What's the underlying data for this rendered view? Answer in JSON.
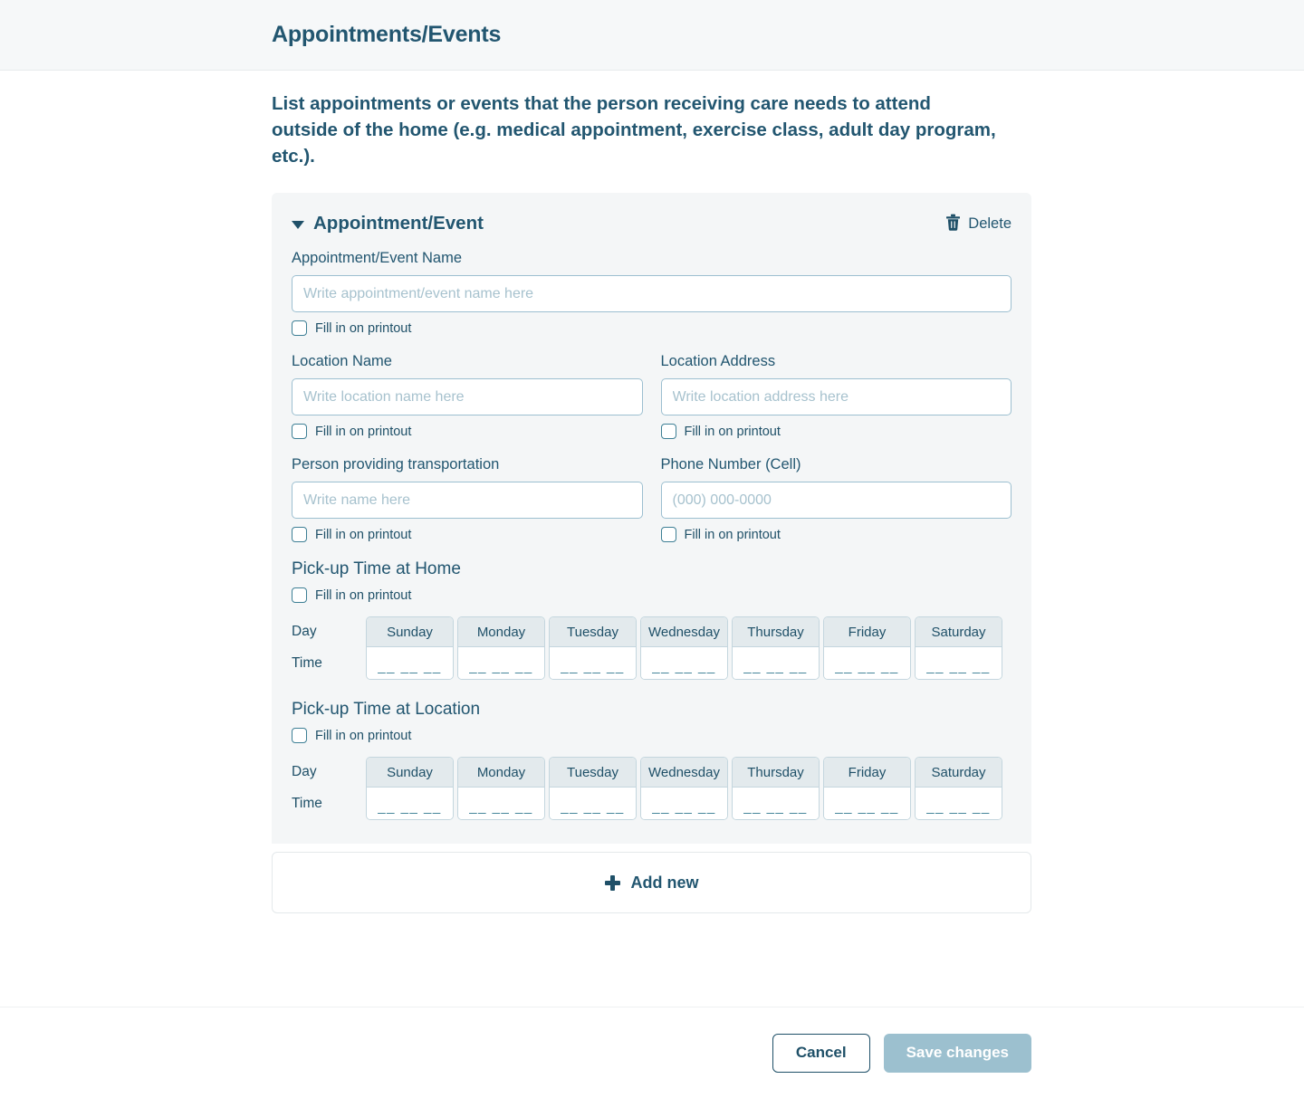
{
  "header": {
    "title": "Appointments/Events"
  },
  "intro": {
    "text": "List appointments or events that the person receiving care needs to attend outside of the home (e.g. medical appointment, exercise class, adult day program, etc.)."
  },
  "card": {
    "title": "Appointment/Event",
    "delete_label": "Delete",
    "caret_icon": "caret-down-icon",
    "delete_icon": "trash-icon",
    "fields": {
      "event_name": {
        "label": "Appointment/Event Name",
        "placeholder": "Write appointment/event name here",
        "value": "",
        "printout_label": "Fill in on printout",
        "printout_checked": false
      },
      "location_name": {
        "label": "Location Name",
        "placeholder": "Write location name here",
        "value": "",
        "printout_label": "Fill in on printout",
        "printout_checked": false
      },
      "location_address": {
        "label": "Location Address",
        "placeholder": "Write location address here",
        "value": "",
        "printout_label": "Fill in on printout",
        "printout_checked": false
      },
      "transport_person": {
        "label": "Person providing transportation",
        "placeholder": "Write name here",
        "value": "",
        "printout_label": "Fill in on printout",
        "printout_checked": false
      },
      "phone_number": {
        "label": "Phone Number (Cell)",
        "placeholder": "(000) 000-0000",
        "value": "",
        "printout_label": "Fill in on printout",
        "printout_checked": false
      }
    },
    "pickup_home": {
      "title": "Pick-up Time at Home",
      "printout_label": "Fill in on printout",
      "printout_checked": false,
      "row_label_day": "Day",
      "row_label_time": "Time",
      "days": [
        "Sunday",
        "Monday",
        "Tuesday",
        "Wednesday",
        "Thursday",
        "Friday",
        "Saturday"
      ],
      "times": [
        "__ __ __",
        "__ __ __",
        "__ __ __",
        "__ __ __",
        "__ __ __",
        "__ __ __",
        "__ __ __"
      ]
    },
    "pickup_location": {
      "title": "Pick-up Time at Location",
      "printout_label": "Fill in on printout",
      "printout_checked": false,
      "row_label_day": "Day",
      "row_label_time": "Time",
      "days": [
        "Sunday",
        "Monday",
        "Tuesday",
        "Wednesday",
        "Thursday",
        "Friday",
        "Saturday"
      ],
      "times": [
        "__ __ __",
        "__ __ __",
        "__ __ __",
        "__ __ __",
        "__ __ __",
        "__ __ __",
        "__ __ __"
      ]
    }
  },
  "add_new": {
    "label": "Add new",
    "icon": "plus-icon"
  },
  "footer": {
    "cancel_label": "Cancel",
    "save_label": "Save changes",
    "save_disabled": true
  },
  "colors": {
    "text_primary": "#225670",
    "input_border": "#9cbfd0",
    "card_bg": "#f4f6f7",
    "header_bg": "#f6f8f9",
    "save_disabled_bg": "#9cc0cf",
    "day_header_bg": "#e3eaed"
  }
}
